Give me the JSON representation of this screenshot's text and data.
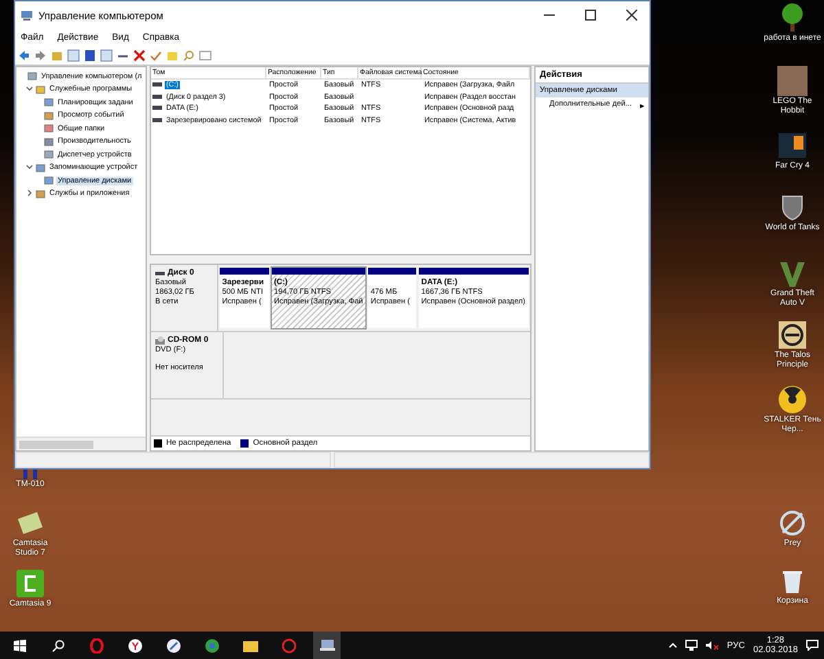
{
  "window": {
    "title": "Управление компьютером",
    "menu": [
      "Файл",
      "Действие",
      "Вид",
      "Справка"
    ],
    "tree": [
      {
        "label": "Управление компьютером (л",
        "selected": false,
        "children": [
          {
            "label": "Служебные программы",
            "expanded": true,
            "selected": false,
            "children": [
              {
                "label": "Планировщик задани",
                "selected": false
              },
              {
                "label": "Просмотр событий",
                "selected": false
              },
              {
                "label": "Общие папки",
                "selected": false
              },
              {
                "label": "Производительность",
                "selected": false
              },
              {
                "label": "Диспетчер устройств",
                "selected": false
              }
            ]
          },
          {
            "label": "Запоминающие устройст",
            "expanded": true,
            "selected": false,
            "children": [
              {
                "label": "Управление дисками",
                "selected": true
              }
            ]
          },
          {
            "label": "Службы и приложения",
            "expanded": false,
            "selected": false
          }
        ]
      }
    ],
    "table": {
      "columns": [
        "Том",
        "Расположение",
        "Тип",
        "Файловая система",
        "Состояние"
      ],
      "rows": [
        {
          "cells": [
            "(C:)",
            "Простой",
            "Базовый",
            "NTFS",
            "Исправен (Загрузка, Файл"
          ],
          "selected": true
        },
        {
          "cells": [
            "(Диск 0 раздел 3)",
            "Простой",
            "Базовый",
            "",
            "Исправен (Раздел восстан"
          ],
          "selected": false
        },
        {
          "cells": [
            "DATA (E:)",
            "Простой",
            "Базовый",
            "NTFS",
            "Исправен (Основной разд"
          ],
          "selected": false
        },
        {
          "cells": [
            "Зарезервировано системой",
            "Простой",
            "Базовый",
            "NTFS",
            "Исправен (Система, Актив"
          ],
          "selected": false
        }
      ]
    },
    "disks": [
      {
        "kind": "disk",
        "name": "Диск 0",
        "lines": [
          "Базовый",
          "1863,02 ГБ",
          "В сети"
        ],
        "partitions": [
          {
            "name": "Зарезерви",
            "size": "500 МБ NTI",
            "status": "Исправен (",
            "selected": false
          },
          {
            "name": "(C:)",
            "size": "194,70 ГБ NTFS",
            "status": "Исправен (Загрузка, Фай",
            "selected": true
          },
          {
            "size": "476 МБ",
            "status": "Исправен (",
            "selected": false
          },
          {
            "name": "DATA  (E:)",
            "size": "1667,36 ГБ NTFS",
            "status": "Исправен (Основной раздел)",
            "selected": false
          }
        ]
      },
      {
        "kind": "cdrom",
        "name": "CD-ROM 0",
        "lines": [
          "DVD (F:)"
        ],
        "status": "Нет носителя"
      }
    ],
    "legend": [
      {
        "label": "Не распределена",
        "color": "#000000"
      },
      {
        "label": "Основной раздел",
        "color": "#000080"
      }
    ],
    "actions": {
      "title": "Действия",
      "items": [
        {
          "kind": "header",
          "label": "Управление дисками"
        },
        {
          "kind": "item",
          "label": "Дополнительные дей...",
          "arrow": "▸"
        }
      ]
    }
  },
  "desktop_icons": [
    {
      "kind": "tree",
      "label": "работа в инете"
    },
    {
      "kind": "photo",
      "label": "LEGO The Hobbit"
    },
    {
      "kind": "fc",
      "label": "Far Cry 4"
    },
    {
      "kind": "tank",
      "label": "World of Tanks"
    },
    {
      "kind": "v",
      "label": "Grand Theft Auto V"
    },
    {
      "kind": "talos",
      "label": "The Talos Principle"
    },
    {
      "kind": "radiation",
      "label": "STALKER Тень Чер..."
    },
    {
      "kind": "prey",
      "label": "Prey"
    },
    {
      "kind": "bin",
      "label": "Корзина"
    }
  ],
  "left_icons": [
    {
      "kind": "tm",
      "label": "TM-010"
    },
    {
      "kind": "camtasia7",
      "label": "Camtasia Studio 7"
    },
    {
      "kind": "camtasia9",
      "label": "Camtasia 9"
    }
  ],
  "taskbar": {
    "language": "РУС",
    "time": "1:28",
    "date": "02.03.2018"
  }
}
